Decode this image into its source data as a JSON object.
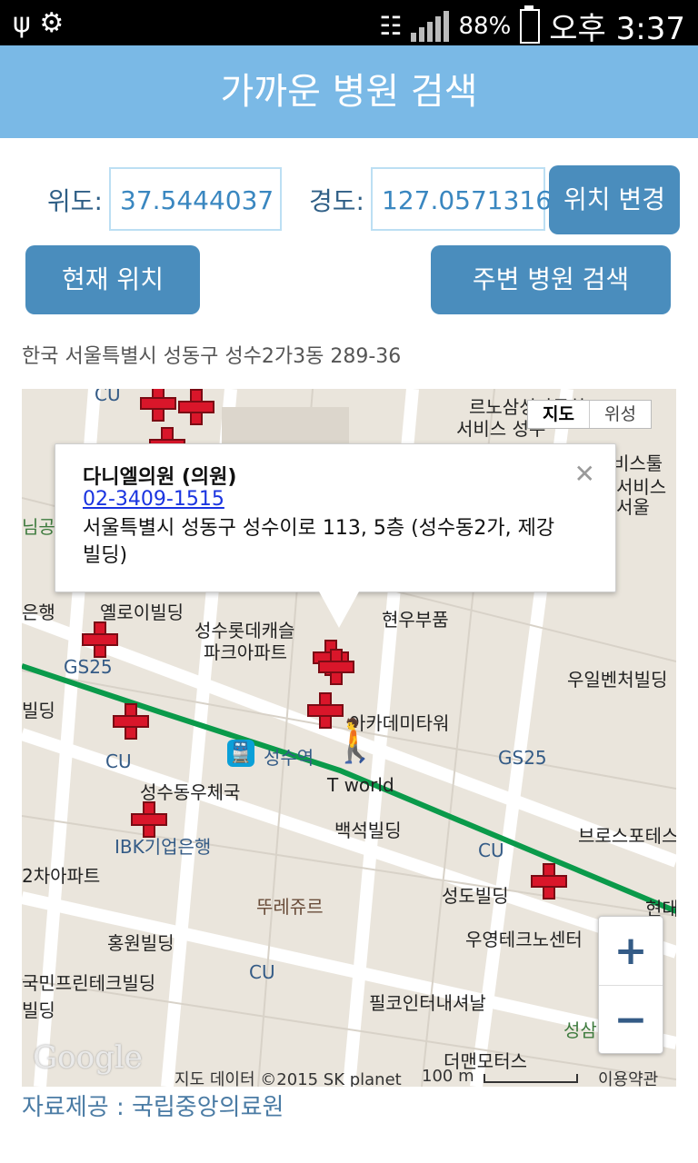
{
  "status_bar": {
    "battery_text": "88%",
    "time": "오후 3:37"
  },
  "header": {
    "title": "가까운 병원 검색"
  },
  "coords": {
    "lat_label": "위도:",
    "lat_value": "37.5444037",
    "lng_label": "경도:",
    "lng_value": "127.0571316",
    "change_button": "위치 변경"
  },
  "buttons": {
    "current_location": "현재 위치",
    "search_nearby": "주변 병원 검색"
  },
  "address": "한국 서울특별시 성동구 성수2가3동 289-36",
  "map": {
    "map_type": {
      "map": "지도",
      "satellite": "위성"
    },
    "popup": {
      "name": "다니엘의원 (의원)",
      "phone": "02-3409-1515",
      "address": "서울특별시 성동구 성수이로 113, 5층 (성수동2가, 제강빌딩)"
    },
    "labels": {
      "cu_top": "CU",
      "service1": "르노삼성자동차",
      "service2": "서비스 성수",
      "service3": "비스툴",
      "service4": "서비스",
      "service5": "서울",
      "park": "님공원",
      "bank_left": "은행",
      "yellow_bldg": "옐로이빌딩",
      "lotte1": "성수롯데캐슬",
      "lotte2": "파크아파트",
      "hyunwoo": "현우부품",
      "gs25_left": "GS25",
      "woil": "우일벤처빌딩",
      "bldg_left": "빌딩",
      "academy": "아카데미타워",
      "cu_mid": "CU",
      "station": "성수역",
      "gs25_right": "GS25",
      "postoffice": "성수동우체국",
      "tworld": "T world",
      "baekseok": "백석빌딩",
      "brothers": "브로스포테스",
      "ibk": "IBK기업은행",
      "cu_right": "CU",
      "apart2": "2차아파트",
      "tous": "뚜레쥬르",
      "seongdo": "성도빌딩",
      "hyeondae": "현대",
      "woyoung": "우영테크노센터",
      "hongwon": "홍원빌딩",
      "cu_bottom": "CU",
      "national": "국민프린테크빌딩",
      "bldg_left2": "빌딩",
      "pilko": "필코인터내셔날",
      "seongsam": "성삼",
      "themen": "더맨모터스",
      "google": "Google",
      "data_credit": "지도 데이터 ©2015 SK planet",
      "scale": "100 m",
      "terms": "이용약관"
    },
    "zoom_in": "+",
    "zoom_out": "−"
  },
  "footer": "자료제공 : 국립중앙의료원",
  "colors": {
    "header_bg": "#7ab9e6",
    "button_bg": "#4a8dbd",
    "marker": "#d9162a",
    "subway_line": "#0a9a4a"
  }
}
